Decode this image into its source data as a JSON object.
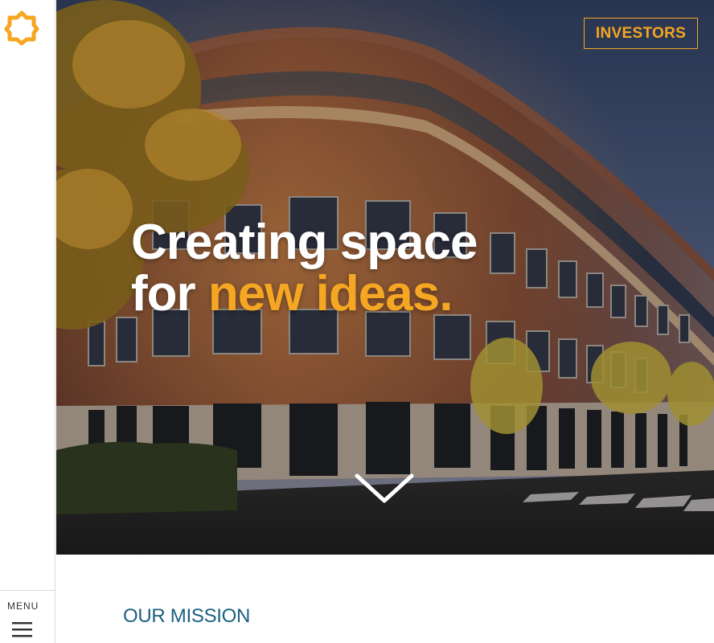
{
  "header": {
    "investors_label": "INVESTORS"
  },
  "hero": {
    "headline_line1": "Creating space",
    "headline_line2_prefix": "for ",
    "headline_line2_accent": "new ideas."
  },
  "sidebar": {
    "menu_label": "MENU"
  },
  "main": {
    "mission_heading": "OUR MISSION"
  },
  "icons": {
    "logo": "star-gear-logo-icon",
    "menu": "hamburger-menu-icon",
    "scroll": "chevron-down-icon"
  },
  "colors": {
    "accent": "#f5a623",
    "mission_text": "#1a5f80",
    "hero_text": "#ffffff"
  }
}
